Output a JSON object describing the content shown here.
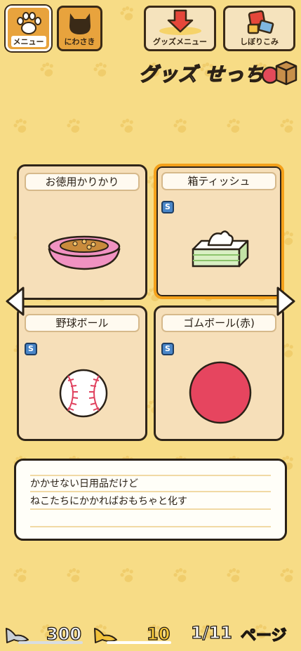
{
  "top_bar": {
    "menu_label": "メニュー",
    "garden_label": "にわさき",
    "goods_menu_label": "グッズメニュー",
    "filter_label": "しぼりこみ"
  },
  "page_title": "グッズ せっち",
  "goods": [
    {
      "name": "お徳用かりかり",
      "badge": "",
      "selected": false,
      "icon": "pink-food-bowl-icon"
    },
    {
      "name": "箱ティッシュ",
      "badge": "S",
      "selected": true,
      "icon": "tissue-box-icon"
    },
    {
      "name": "野球ボール",
      "badge": "S",
      "selected": false,
      "icon": "baseball-icon"
    },
    {
      "name": "ゴムボール(赤)",
      "badge": "S",
      "selected": false,
      "icon": "red-rubber-ball-icon"
    }
  ],
  "description": {
    "line1": "かかせない日用品だけど",
    "line2": "ねこたちにかかればおもちゃと化す"
  },
  "status": {
    "silver_fish": "300",
    "gold_fish": "10",
    "page": "1/11",
    "page_suffix": "ページ"
  },
  "colors": {
    "background": "#f7dc86",
    "card": "#f6dfb9",
    "selected_border": "#f4a11a",
    "badge": "#4a86c8"
  }
}
